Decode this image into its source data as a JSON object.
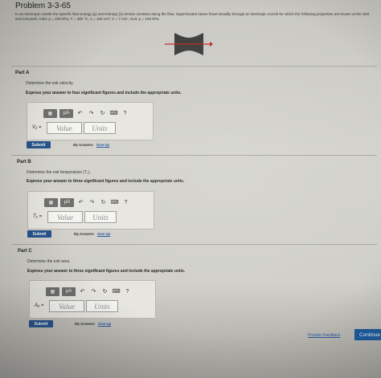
{
  "problem": {
    "title": "Problem 3-3-65",
    "intro": "In an isentropic nozzle the specific flow energy (ρ) and entropy (s) remain constant along the flow. Superheated steam flows steadily through an isentropic nozzle for which the following properties are known at the inlet and exit ports. Inlet: p = 200 kPa, T = 400 °C, A = 100 cm², V = 7 m/s ; Exit: p = 100 kPa."
  },
  "toolbar": {
    "undo": "↶",
    "redo": "↷",
    "reset": "↻",
    "keyboard": "⌨",
    "help": "?",
    "units_label": "μA"
  },
  "parts": [
    {
      "label": "Part A",
      "question": "Determine the exit velocity.",
      "instruction": "Express your answer to four significant figures and include the appropriate units.",
      "variable": "V₂ =",
      "value_placeholder": "Value",
      "units_placeholder": "Units",
      "submit": "Submit",
      "my_answers": "My Answers",
      "give_up": "Give Up"
    },
    {
      "label": "Part B",
      "question": "Determine the exit temperature (T₂).",
      "instruction": "Express your answer to three significant figures and include the appropriate units.",
      "variable": "T₂ =",
      "value_placeholder": "Value",
      "units_placeholder": "Units",
      "submit": "Submit",
      "my_answers": "My Answers",
      "give_up": "Give Up"
    },
    {
      "label": "Part C",
      "question": "Determine the exit area.",
      "instruction": "Express your answer to three significant figures and include the appropriate units.",
      "variable": "A₂ =",
      "value_placeholder": "Value",
      "units_placeholder": "Units",
      "submit": "Submit",
      "my_answers": "My Answers",
      "give_up": "Give Up"
    }
  ],
  "footer": {
    "feedback": "Provide Feedback",
    "continue": "Continue"
  }
}
